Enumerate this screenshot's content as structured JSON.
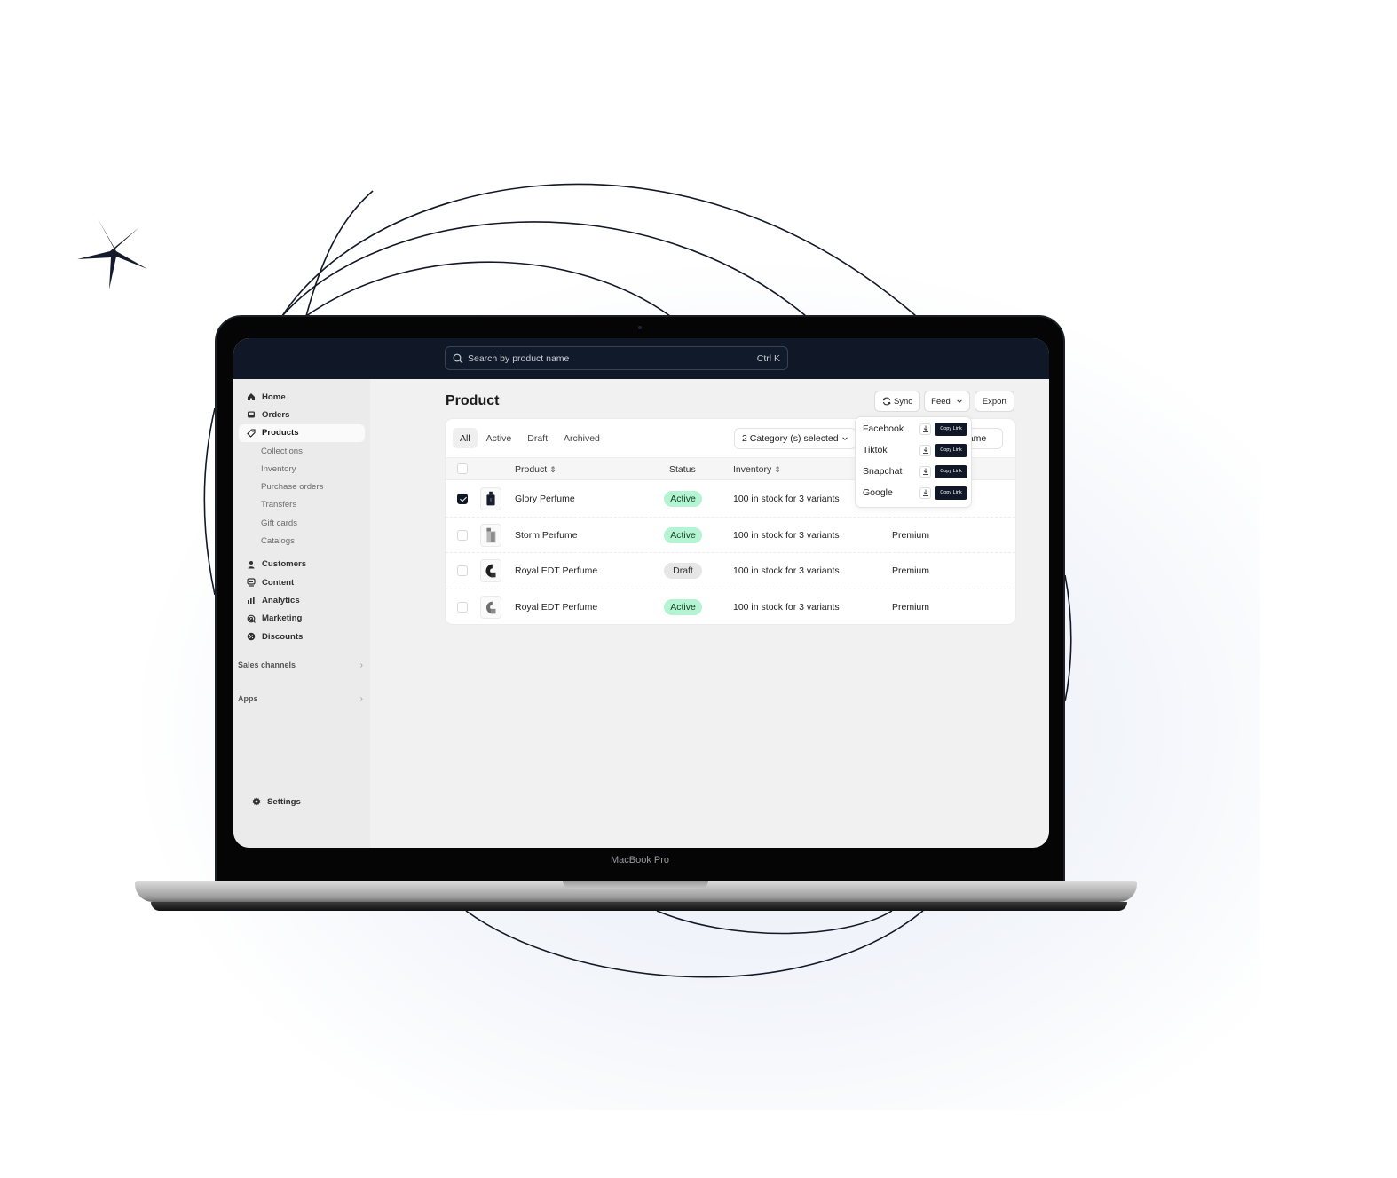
{
  "device": {
    "label": "MacBook Pro"
  },
  "topbar": {
    "search_placeholder": "Search by product name",
    "shortcut": "Ctrl K"
  },
  "sidebar": {
    "items": [
      {
        "label": "Home",
        "icon": "home-icon"
      },
      {
        "label": "Orders",
        "icon": "inbox-icon"
      },
      {
        "label": "Products",
        "icon": "tag-icon",
        "active": true
      }
    ],
    "product_sub_items": [
      "Collections",
      "Inventory",
      "Purchase orders",
      "Transfers",
      "Gift cards",
      "Catalogs"
    ],
    "items2": [
      {
        "label": "Customers",
        "icon": "person-icon"
      },
      {
        "label": "Content",
        "icon": "content-icon"
      },
      {
        "label": "Analytics",
        "icon": "bar-chart-icon"
      },
      {
        "label": "Marketing",
        "icon": "target-icon"
      },
      {
        "label": "Discounts",
        "icon": "discount-icon"
      }
    ],
    "sections": [
      "Sales channels",
      "Apps"
    ],
    "settings": "Settings"
  },
  "main": {
    "title": "Product",
    "actions": {
      "sync": "Sync",
      "feed": "Feed",
      "export": "Export"
    },
    "tabs": [
      "All",
      "Active",
      "Draft",
      "Archived"
    ],
    "selected_tab": "All",
    "category_filter": "2 Category (s) selected",
    "sort_filter": "name",
    "columns": [
      "Product",
      "Status",
      "Inventory"
    ],
    "rows": [
      {
        "name": "Glory Perfume",
        "status": "Active",
        "inventory": "100 in stock for 3 variants",
        "tier": "",
        "checked": true
      },
      {
        "name": "Storm Perfume",
        "status": "Active",
        "inventory": "100 in stock for 3 variants",
        "tier": "Premium",
        "checked": false
      },
      {
        "name": "Royal EDT Perfume",
        "status": "Draft",
        "inventory": "100 in stock for 3 variants",
        "tier": "Premium",
        "checked": false
      },
      {
        "name": "Royal EDT Perfume",
        "status": "Active",
        "inventory": "100 in stock for 3 variants",
        "tier": "Premium",
        "checked": false
      }
    ],
    "feed_menu": {
      "copy_label": "Copy Link",
      "items": [
        "Facebook",
        "Tiktok",
        "Snapchat",
        "Google"
      ]
    }
  },
  "colors": {
    "topbar": "#101726",
    "active_badge": "#b4f4d2",
    "draft_badge": "#e6e6e6",
    "primary_dark": "#101726"
  }
}
